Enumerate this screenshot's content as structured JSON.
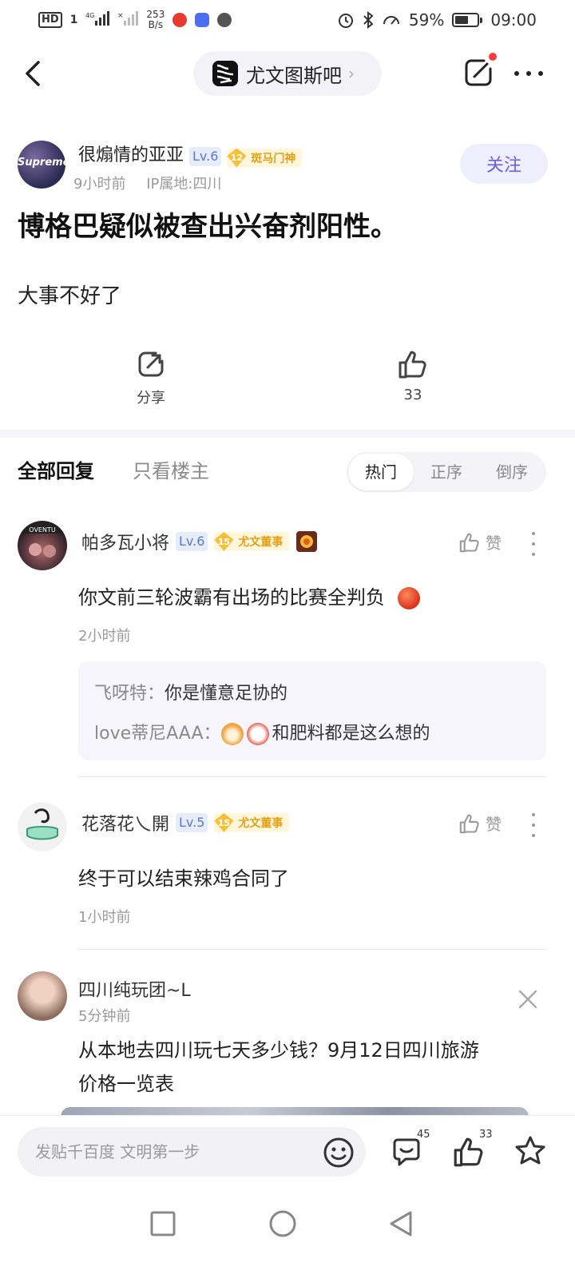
{
  "status_bar": {
    "hd": "HD",
    "sim": "1",
    "network": "4G",
    "speed_value": "253",
    "speed_unit": "B/s",
    "battery": "59%",
    "time": "09:00"
  },
  "header": {
    "forum_name": "尤文图斯吧",
    "forum_arrow": "›"
  },
  "post": {
    "author": {
      "name": "很煽情的亚亚",
      "level": "Lv.6",
      "badge_num": "12",
      "badge_title": "斑马门神",
      "avatar_text": "Supreme",
      "time": "9小时前",
      "ip": "IP属地:四川"
    },
    "follow_label": "关注",
    "title": "博格巴疑似被查出兴奋剂阳性。",
    "body": "大事不好了",
    "share_label": "分享",
    "like_count": "33"
  },
  "reply_tabs": {
    "all": "全部回复",
    "op_only": "只看楼主",
    "sort": [
      "热门",
      "正序",
      "倒序"
    ],
    "sort_active": 0
  },
  "comments": [
    {
      "user": "帕多瓦小将",
      "level": "Lv.6",
      "badge_num": "15",
      "badge_title": "尤文董事",
      "text": "你文前三轮波霸有出场的比赛全判负",
      "time": "2小时前",
      "like_label": "赞",
      "replies": [
        {
          "user": "飞呀特：",
          "text": "你是懂意足协的"
        },
        {
          "user": "love蒂尼AAA：",
          "text": "和肥料都是这么想的"
        }
      ]
    },
    {
      "user": "花落花乀開",
      "level": "Lv.5",
      "badge_num": "15",
      "badge_title": "尤文董事",
      "text": "终于可以结束辣鸡合同了",
      "time": "1小时前",
      "like_label": "赞"
    },
    {
      "user": "四川纯玩团~L",
      "time": "5分钟前",
      "text_line1": "从本地去四川玩七天多少钱？9月12日四川旅游",
      "text_line2": "价格一览表"
    }
  ],
  "bottom_bar": {
    "placeholder": "发贴千百度 文明第一步",
    "comment_count": "45",
    "like_count": "33"
  },
  "colors": {
    "accent": "#6b5fe0",
    "level_blue": "#5a7ac8",
    "badge_gold": "#e2a21b"
  }
}
